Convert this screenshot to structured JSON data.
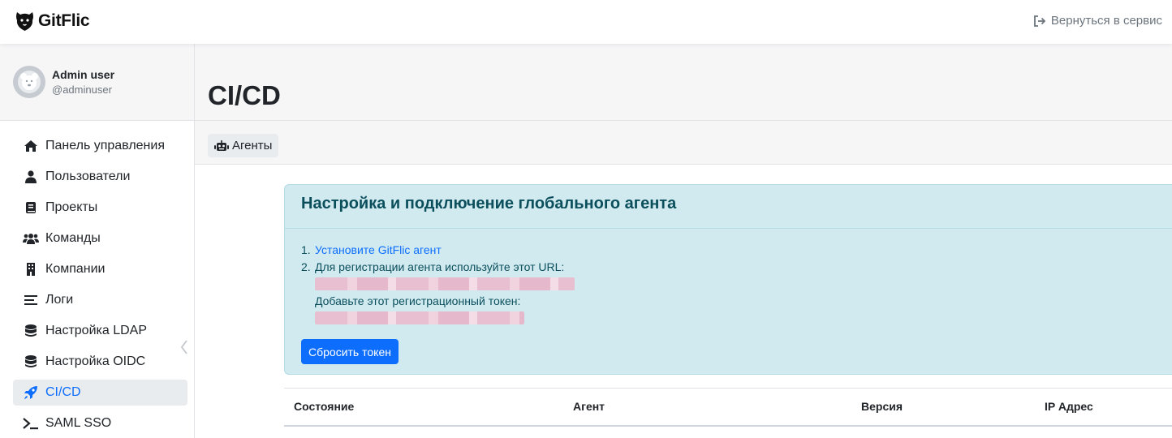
{
  "header": {
    "logo_text": "GitFlic",
    "back_label": "Вернуться в сервис"
  },
  "user": {
    "name": "Admin user",
    "handle": "@adminuser"
  },
  "sidebar": {
    "items": [
      {
        "label": "Панель управления",
        "icon": "home-icon"
      },
      {
        "label": "Пользователи",
        "icon": "user-icon"
      },
      {
        "label": "Проекты",
        "icon": "book-icon"
      },
      {
        "label": "Команды",
        "icon": "users-icon"
      },
      {
        "label": "Компании",
        "icon": "building-icon"
      },
      {
        "label": "Логи",
        "icon": "list-icon"
      },
      {
        "label": "Настройка LDAP",
        "icon": "database-icon"
      },
      {
        "label": "Настройка OIDC",
        "icon": "database-icon"
      },
      {
        "label": "CI/CD",
        "icon": "rocket-icon",
        "active": true
      },
      {
        "label": "SAML SSO",
        "icon": "terminal-icon"
      }
    ]
  },
  "main": {
    "title": "CI/CD",
    "tabs": [
      {
        "label": "Агенты",
        "icon": "robot-icon"
      }
    ],
    "setup": {
      "title": "Настройка и подключение глобального агента",
      "step1_link": "Установите GitFlic агент",
      "step2_text": "Для регистрации агента используйте этот URL:",
      "token_text": "Добавьте этот регистрационный токен:",
      "reset_button": "Сбросить токен"
    },
    "table": {
      "columns": [
        "Состояние",
        "Агент",
        "Версия",
        "IP Адрес"
      ]
    }
  },
  "colors": {
    "accent": "#0d6efd",
    "alert_bg": "#d1eaf0",
    "alert_text": "#0b4f5c"
  }
}
